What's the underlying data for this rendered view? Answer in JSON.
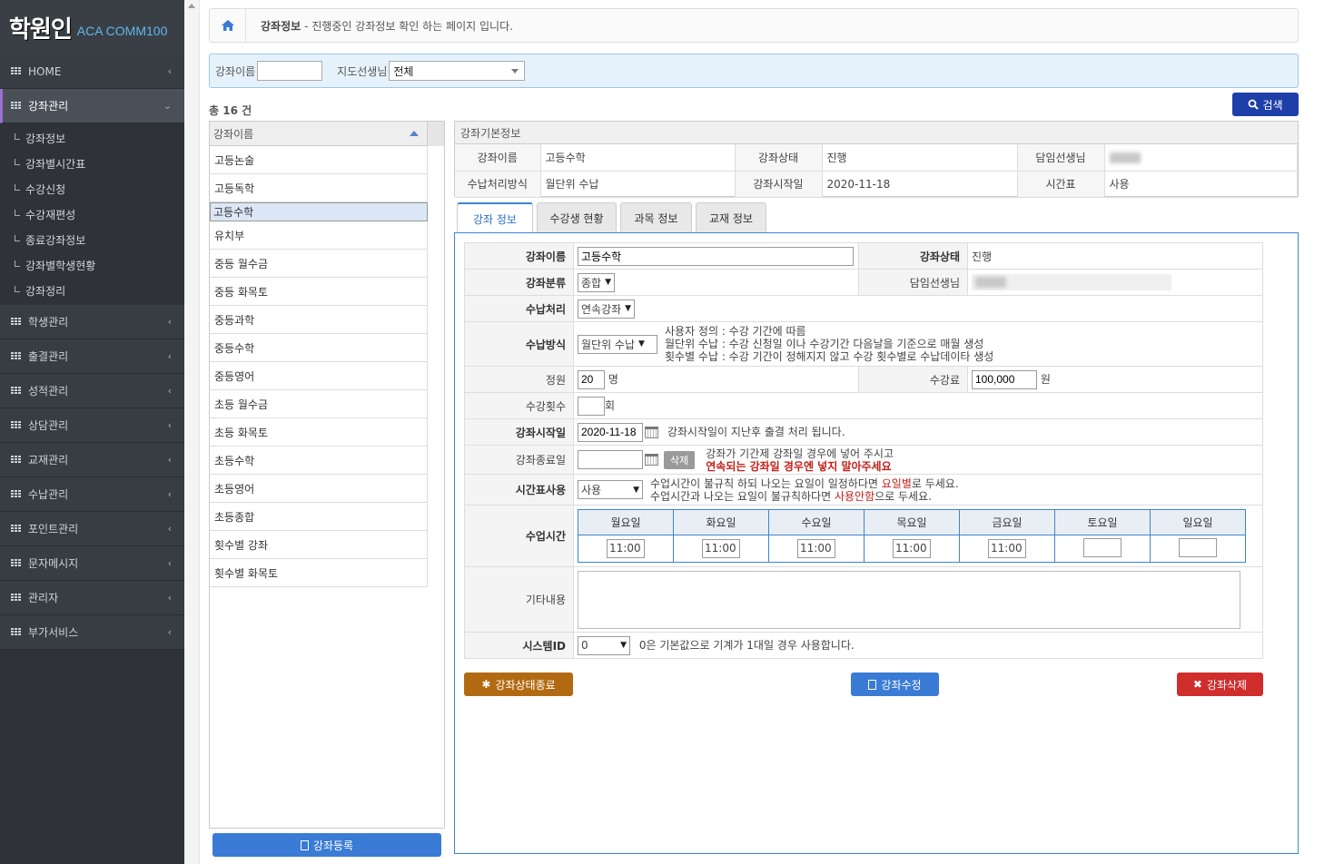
{
  "logo": {
    "mark": "학원인",
    "sub": "ACA COMM100"
  },
  "sidebar": {
    "home": "HOME",
    "course_mgmt": "강좌관리",
    "course_sub": [
      "강좌정보",
      "강좌별시간표",
      "수강신청",
      "수강재편성",
      "종료강좌정보",
      "강좌별학생현황",
      "강좌정리"
    ],
    "menus": [
      "학생관리",
      "출결관리",
      "성적관리",
      "상담관리",
      "교재관리",
      "수납관리",
      "포인트관리",
      "문자메시지",
      "관리자",
      "부가서비스"
    ]
  },
  "breadcrumb": {
    "title": "강좌정보",
    "desc": "- 진행중인 강좌정보 확인 하는 페이지 입니다."
  },
  "search": {
    "course_label": "강좌이름",
    "course_value": "",
    "teacher_label": "지도선생님",
    "teacher_value": "전체",
    "button": "검색"
  },
  "count": "총 16 건",
  "list": {
    "header": "강좌이름",
    "items": [
      "고등논술",
      "고등독학",
      "고등수학",
      "유치부",
      "중등 월수금",
      "중등 화목토",
      "중등과학",
      "중등수학",
      "중등영어",
      "초등 월수금",
      "초등 화목토",
      "초등수학",
      "초등영어",
      "초등종합",
      "횟수별 강좌",
      "횟수별 화목토"
    ],
    "selected": 2,
    "register": "강좌등록"
  },
  "basic": {
    "title": "강좌기본정보",
    "row1": {
      "l1": "강좌이름",
      "v1": "고등수학",
      "l2": "강좌상태",
      "v2": "진행",
      "l3": "담임선생님"
    },
    "row2": {
      "l1": "수납처리방식",
      "v1": "월단위 수납",
      "l2": "강좌시작일",
      "v2": "2020-11-18",
      "l3": "시간표",
      "v3": "사용"
    }
  },
  "tabs": [
    "강좌 정보",
    "수강생 현황",
    "과목 정보",
    "교재 정보"
  ],
  "form": {
    "name_label": "강좌이름",
    "name_value": "고등수학",
    "status_label": "강좌상태",
    "status_value": "진행",
    "category_label": "강좌분류",
    "category_value": "종합",
    "teacher_label": "담임선생님",
    "pay_label": "수납처리",
    "pay_value": "연속강좌",
    "method_label": "수납방식",
    "method_value": "월단위 수납",
    "method_notes": [
      "사용자 정의 : 수강 기간에 따름",
      "월단위 수납 : 수강 신청일 이나 수강기간 다음날을 기준으로 매월 생성",
      "횟수별 수납 : 수강 기간이 정해지지 않고 수강 횟수별로 수납데이타 생성"
    ],
    "capacity_label": "정원",
    "capacity_value": "20",
    "capacity_unit": "명",
    "fee_label": "수강료",
    "fee_value": "100,000",
    "fee_unit": "원",
    "count_label": "수강횟수",
    "count_value": "",
    "count_unit": "회",
    "start_label": "강좌시작일",
    "start_value": "2020-11-18",
    "start_note": "강좌시작일이 지난후 출결 처리 됩니다.",
    "end_label": "강좌종료일",
    "end_value": "",
    "end_delete": "삭제",
    "end_note1": "강좌가 기간제 강좌일 경우에 넣어 주시고",
    "end_note2": "연속되는 강좌일 경우엔 넣지 말아주세요",
    "timetable_label": "시간표사용",
    "timetable_value": "사용",
    "tt_note1a": "수업시간이 불규칙 하되 나오는 요일이 일정하다면 ",
    "tt_note1b": "요일별",
    "tt_note1c": "로 두세요.",
    "tt_note2a": "수업시간과 나오는 요일이 불규칙하다면 ",
    "tt_note2b": "사용안함",
    "tt_note2c": "으로 두세요.",
    "class_time_label": "수업시간",
    "days": [
      "월요일",
      "화요일",
      "수요일",
      "목요일",
      "금요일",
      "토요일",
      "일요일"
    ],
    "times": [
      "11:00",
      "11:00",
      "11:00",
      "11:00",
      "11:00",
      "",
      ""
    ],
    "memo_label": "기타내용",
    "system_label": "시스템ID",
    "system_value": "0",
    "system_note": "0은 기본값으로 기계가 1대일 경우 사용합니다."
  },
  "actions": {
    "end": "강좌상태종료",
    "edit": "강좌수정",
    "delete": "강좌삭제"
  },
  "colors": {
    "sidebar": "#2f3338",
    "accent": "#3a86d4",
    "search_btn": "#1f3fa8",
    "end_btn": "#b26a12",
    "delete_btn": "#d02d2d"
  }
}
